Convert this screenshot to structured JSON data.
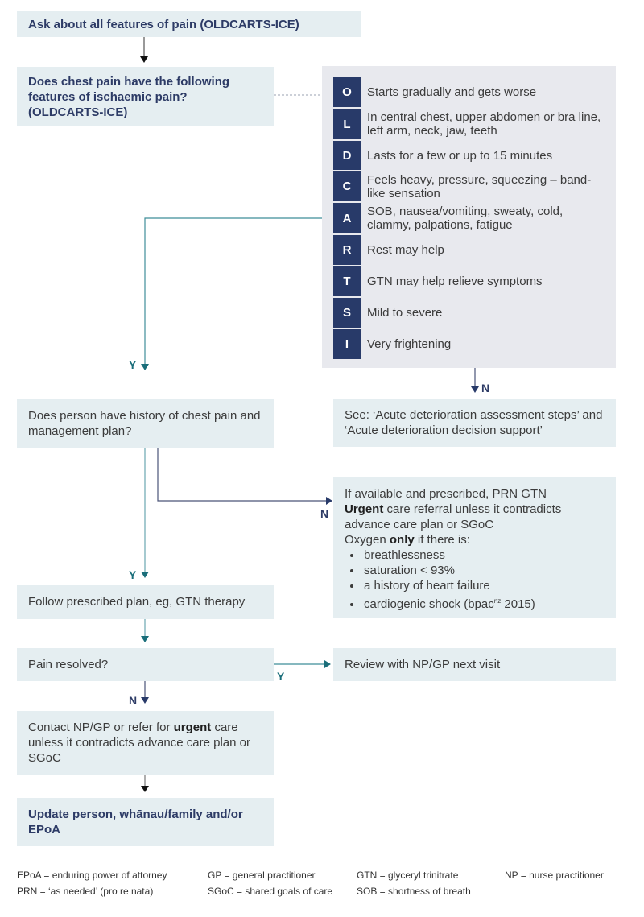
{
  "nodes": {
    "start": "Ask about all features of pain (OLDCARTS-ICE)",
    "ischaemic_question": "Does chest pain have the following features of ischaemic pain? (OLDCARTS-ICE)",
    "history_question": "Does person have history of chest pain and management plan?",
    "see_other": "See: ‘Acute deterioration assessment steps’ and ‘Acute deterioration decision support’",
    "prn": {
      "line1": "If available and prescribed, PRN GTN",
      "line2_bold": "Urgent",
      "line2_rest": " care referral unless it contradicts advance care plan or SGoC",
      "line3_pre": "Oxygen ",
      "line3_bold": "only",
      "line3_post": " if there is:",
      "bullets": [
        "breathlessness",
        "saturation < 93%",
        "a history of heart failure",
        "cardiogenic shock (bpac"
      ],
      "bullet4_sup": "nz",
      "bullet4_tail": " 2015)"
    },
    "follow_plan": "Follow prescribed plan, eg, GTN therapy",
    "pain_resolved": "Pain resolved?",
    "review": "Review with NP/GP next visit",
    "contact": {
      "pre": "Contact NP/GP or refer for ",
      "bold": "urgent",
      "post": " care unless it contradicts advance care plan or SGoC"
    },
    "update": "Update person, whānau/family and/or EPoA"
  },
  "oldcarts": [
    {
      "letter": "O",
      "text": "Starts gradually and gets worse"
    },
    {
      "letter": "L",
      "text": "In central chest, upper abdomen or bra line, left arm, neck, jaw, teeth"
    },
    {
      "letter": "D",
      "text": "Lasts for a few or up to 15 minutes"
    },
    {
      "letter": "C",
      "text": "Feels heavy, pressure, squeezing – band-like sensation"
    },
    {
      "letter": "A",
      "text": "SOB, nausea/vomiting, sweaty, cold, clammy, palpations, fatigue"
    },
    {
      "letter": "R",
      "text": "Rest may help"
    },
    {
      "letter": "T",
      "text": "GTN may help relieve symptoms"
    },
    {
      "letter": "S",
      "text": "Mild to severe"
    },
    {
      "letter": "I",
      "text": "Very frightening"
    }
  ],
  "edge_labels": {
    "yes": "Y",
    "no": "N"
  },
  "legend": [
    "EPoA = enduring power of attorney",
    "GP = general practitioner",
    "GTN = glyceryl trinitrate",
    "NP = nurse practitioner",
    "PRN = ‘as needed’ (pro re nata)",
    "SGoC = shared goals of care",
    "SOB = shortness of breath"
  ],
  "colors": {
    "box_bg": "#e5eef1",
    "panel_bg": "#e8e9ee",
    "navy": "#283a69",
    "teal": "#1a6e7a"
  }
}
